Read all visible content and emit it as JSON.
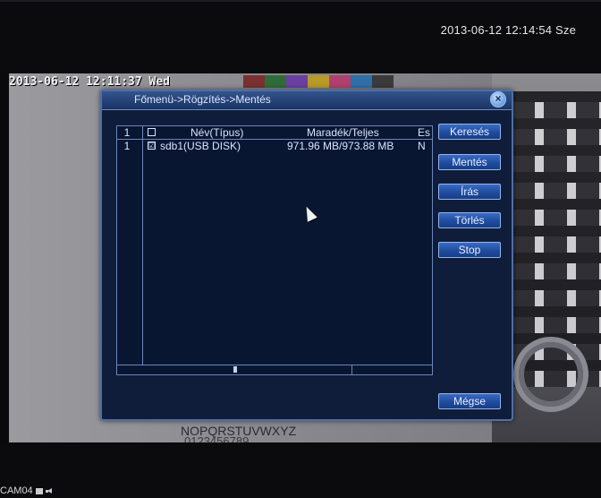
{
  "top": {
    "datetime": "2013-06-12 12:14:54 Sze"
  },
  "feed": {
    "overlay_time": "2013-06-12 12:11:37 Wed",
    "chart_text": "NOPQRSTUVWXYZ",
    "chart_text2": "0123456789"
  },
  "bottom": {
    "camera_label": "CAM04"
  },
  "dialog": {
    "title": "Főmenü->Rögzítés->Mentés",
    "close_label": "×",
    "table": {
      "header": {
        "index": "1",
        "name": "Név(Típus)",
        "size": "Maradék/Teljes",
        "extra": "Es"
      },
      "rows": [
        {
          "index": "1",
          "checked": "☑",
          "name": "sdb1(USB DISK)",
          "size": "971.96 MB/973.88 MB",
          "extra": "N"
        }
      ]
    },
    "buttons": {
      "search": "Keresés",
      "backup": "Mentés",
      "write": "Írás",
      "delete": "Törlés",
      "stop": "Stop",
      "cancel": "Mégse"
    }
  },
  "colors": {
    "dialog_bg": "#101d3a",
    "button_blue": "#1f4c9e",
    "border": "#6c86b8"
  }
}
